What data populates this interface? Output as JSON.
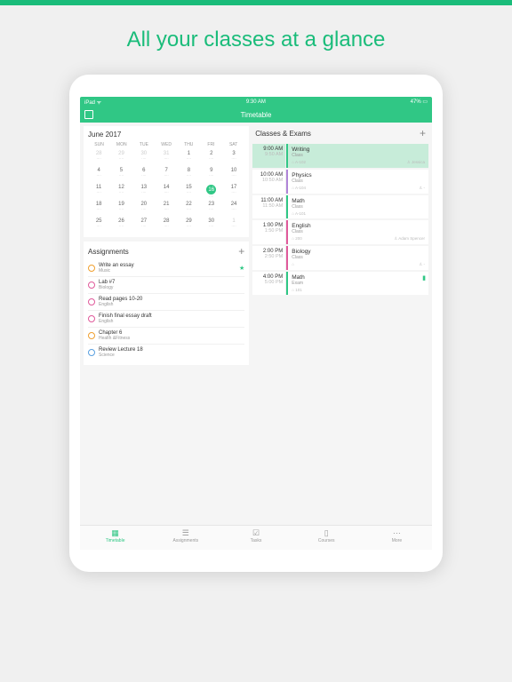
{
  "headline": "All your classes at a glance",
  "status": {
    "left": "iPad ᯤ",
    "center": "9:30 AM",
    "right": "47% ▭"
  },
  "navbar": {
    "title": "Timetable"
  },
  "calendar": {
    "title": "June 2017",
    "daynames": [
      "SUN",
      "MON",
      "TUE",
      "WED",
      "THU",
      "FRI",
      "SAT"
    ],
    "weeks": [
      [
        {
          "n": "28",
          "dim": true
        },
        {
          "n": "29",
          "dim": true
        },
        {
          "n": "30",
          "dim": true
        },
        {
          "n": "31",
          "dim": true
        },
        {
          "n": "1"
        },
        {
          "n": "2"
        },
        {
          "n": "3"
        }
      ],
      [
        {
          "n": "4"
        },
        {
          "n": "5"
        },
        {
          "n": "6"
        },
        {
          "n": "7"
        },
        {
          "n": "8"
        },
        {
          "n": "9"
        },
        {
          "n": "10"
        }
      ],
      [
        {
          "n": "11"
        },
        {
          "n": "12"
        },
        {
          "n": "13"
        },
        {
          "n": "14"
        },
        {
          "n": "15"
        },
        {
          "n": "16",
          "today": true
        },
        {
          "n": "17"
        }
      ],
      [
        {
          "n": "18"
        },
        {
          "n": "19"
        },
        {
          "n": "20"
        },
        {
          "n": "21"
        },
        {
          "n": "22"
        },
        {
          "n": "23"
        },
        {
          "n": "24"
        }
      ],
      [
        {
          "n": "25"
        },
        {
          "n": "26"
        },
        {
          "n": "27"
        },
        {
          "n": "28"
        },
        {
          "n": "29"
        },
        {
          "n": "30"
        },
        {
          "n": "1",
          "dim": true
        }
      ]
    ]
  },
  "assignments": {
    "title": "Assignments",
    "items": [
      {
        "title": "Write an essay",
        "sub": "Music",
        "color": "#f0a030",
        "star": true
      },
      {
        "title": "Lab #7",
        "sub": "Biology",
        "color": "#e05a9b"
      },
      {
        "title": "Read pages 10-20",
        "sub": "English",
        "color": "#e05a9b"
      },
      {
        "title": "Finish final essay draft",
        "sub": "English",
        "color": "#e05a9b"
      },
      {
        "title": "Chapter 6",
        "sub": "Health &Fitness",
        "color": "#f0a030"
      },
      {
        "title": "Review Lecture 18",
        "sub": "Science",
        "color": "#5aa0e0"
      }
    ]
  },
  "classes": {
    "title": "Classes & Exams",
    "items": [
      {
        "t1": "9:00 AM",
        "t2": "9:50 AM",
        "name": "Writing",
        "type": "Class",
        "room": "A-102",
        "teacher": "Jessica",
        "color": "#30c785",
        "hl": true
      },
      {
        "t1": "10:00 AM",
        "t2": "10:50 AM",
        "name": "Physics",
        "type": "Class",
        "room": "A-104",
        "teacher": "-",
        "color": "#b085d8"
      },
      {
        "t1": "11:00 AM",
        "t2": "11:50 AM",
        "name": "Math",
        "type": "Class",
        "room": "A-101",
        "teacher": "",
        "color": "#30c785"
      },
      {
        "t1": "1:00 PM",
        "t2": "1:50 PM",
        "name": "English",
        "type": "Class",
        "room": "200",
        "teacher": "Adam Spencer",
        "color": "#e05a9b"
      },
      {
        "t1": "2:00 PM",
        "t2": "2:50 PM",
        "name": "Biology",
        "type": "Class",
        "room": "",
        "teacher": "-",
        "color": "#e05a9b"
      },
      {
        "t1": "4:00 PM",
        "t2": "5:00 PM",
        "name": "Math",
        "type": "Exam",
        "room": "101",
        "teacher": "",
        "color": "#30c785",
        "bookmark": true
      }
    ]
  },
  "tabs": [
    {
      "label": "Timetable",
      "icon": "▦",
      "active": true
    },
    {
      "label": "Assignments",
      "icon": "☰"
    },
    {
      "label": "Tasks",
      "icon": "☑"
    },
    {
      "label": "Courses",
      "icon": "▯"
    },
    {
      "label": "More",
      "icon": "⋯"
    }
  ]
}
